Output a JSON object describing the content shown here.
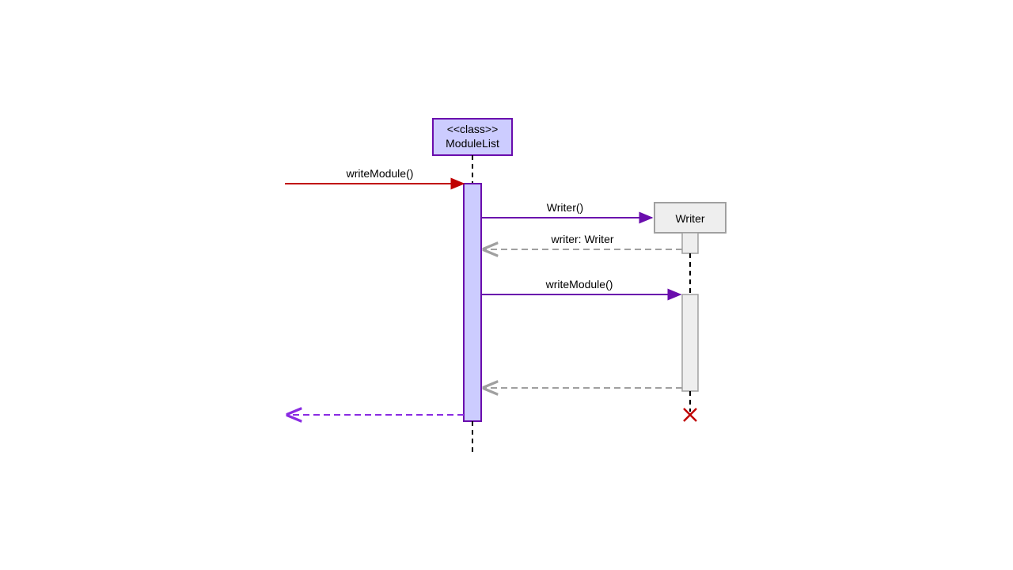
{
  "diagram": {
    "type": "uml-sequence",
    "participants": {
      "moduleList": {
        "stereotype": "<<class>>",
        "name": "ModuleList",
        "fill": "#CCCCFF",
        "stroke": "#6A0DAD"
      },
      "writer": {
        "name": "Writer",
        "fill": "#EEEEEE",
        "stroke": "#A0A0A0"
      }
    },
    "messages": {
      "inbound": {
        "label": "writeModule()",
        "style": "found-red-solid",
        "from": "external",
        "to": "moduleList"
      },
      "createWriter": {
        "label": "Writer()",
        "style": "purple-solid",
        "from": "moduleList",
        "to": "writer",
        "kind": "create"
      },
      "returnWriter": {
        "label": "writer: Writer",
        "style": "gray-dashed-return",
        "from": "writer",
        "to": "moduleList"
      },
      "callWrite": {
        "label": "writeModule()",
        "style": "purple-solid",
        "from": "moduleList",
        "to": "writer"
      },
      "returnWrite": {
        "label": "",
        "style": "gray-dashed-return",
        "from": "writer",
        "to": "moduleList"
      },
      "outboundReturn": {
        "label": "",
        "style": "purple-dashed-return",
        "from": "moduleList",
        "to": "external"
      },
      "destroyWriter": {
        "kind": "destroy",
        "target": "writer"
      }
    },
    "colors": {
      "accentPurple": "#6A0DAD",
      "lavenderFill": "#CCCCFF",
      "grayFill": "#EEEEEE",
      "grayStroke": "#A0A0A0",
      "foundRed": "#C00000",
      "returnPurple": "#8A2BE2"
    }
  }
}
